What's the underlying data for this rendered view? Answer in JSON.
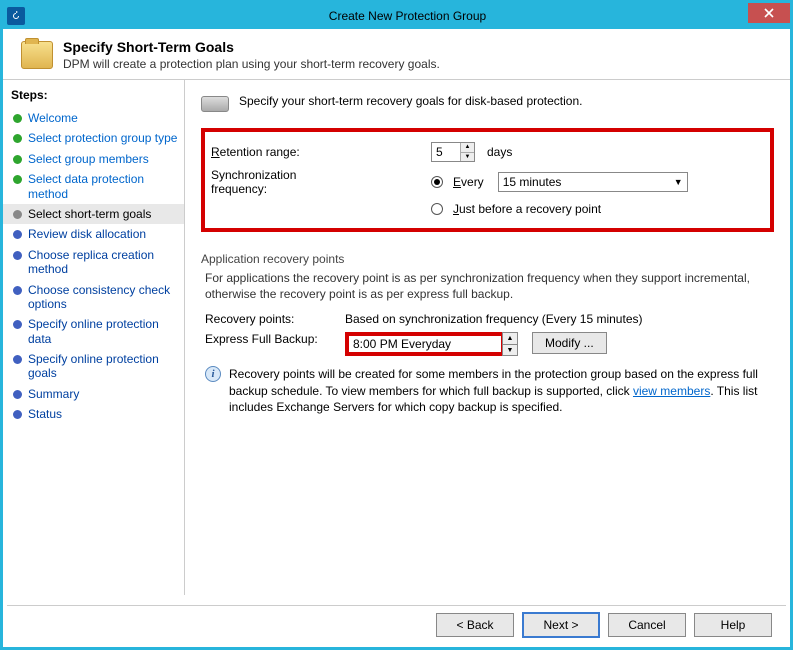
{
  "window": {
    "title": "Create New Protection Group"
  },
  "header": {
    "title": "Specify Short-Term Goals",
    "subtitle": "DPM will create a protection plan using your short-term recovery goals."
  },
  "stepsLabel": "Steps:",
  "steps": [
    {
      "label": "Welcome",
      "state": "done"
    },
    {
      "label": "Select protection group type",
      "state": "done"
    },
    {
      "label": "Select group members",
      "state": "done"
    },
    {
      "label": "Select data protection method",
      "state": "done"
    },
    {
      "label": "Select short-term goals",
      "state": "current"
    },
    {
      "label": "Review disk allocation",
      "state": "pending"
    },
    {
      "label": "Choose replica creation method",
      "state": "pending"
    },
    {
      "label": "Choose consistency check options",
      "state": "pending"
    },
    {
      "label": "Specify online protection data",
      "state": "pending"
    },
    {
      "label": "Specify online protection goals",
      "state": "pending"
    },
    {
      "label": "Summary",
      "state": "pending"
    },
    {
      "label": "Status",
      "state": "pending"
    }
  ],
  "main": {
    "intro": "Specify your short-term recovery goals for disk-based protection.",
    "retentionLabel": "Retention range:",
    "retentionValue": "5",
    "retentionUnit": "days",
    "syncLabel": "Synchronization frequency:",
    "syncEvery": "Every",
    "syncEveryValue": "15 minutes",
    "syncJustBefore": "Just before a recovery point",
    "arp": {
      "group": "Application recovery points",
      "desc": "For applications the recovery point is as per synchronization frequency when they support incremental, otherwise the recovery point is as per express full backup.",
      "recPointsLabel": "Recovery points:",
      "recPointsValue": "Based on synchronization frequency (Every 15 minutes)",
      "expressLabel": "Express Full Backup:",
      "expressValue": "8:00 PM Everyday",
      "modify": "Modify ...",
      "info1": "Recovery points will be created for some members in the protection group based on the express full backup schedule. To view members for which full backup is supported, click ",
      "infoLink": "view members",
      "info2": ". This list includes Exchange Servers for which copy backup is specified."
    }
  },
  "buttons": {
    "back": "< Back",
    "next": "Next >",
    "cancel": "Cancel",
    "help": "Help"
  }
}
